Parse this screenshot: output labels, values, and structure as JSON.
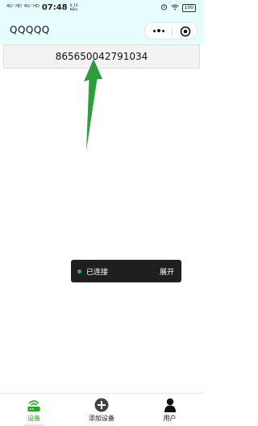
{
  "status_bar": {
    "signal_1": "4G⁺ HD",
    "signal_2": "4G⁺ HD",
    "time": "07:48",
    "net_speed": "6.10 KB/s",
    "battery": "100"
  },
  "title_bar": {
    "title": "QQQQQ",
    "more_icon": "more-dots-icon",
    "close_icon": "circle-target-icon"
  },
  "device_id": "865650042791034",
  "toast": {
    "status": "已连接",
    "expand": "展开",
    "dot_color": "#18c15a"
  },
  "tabs": [
    {
      "label": "设备",
      "icon": "router-icon",
      "active": true
    },
    {
      "label": "添加设备",
      "icon": "plus-circle-icon",
      "active": false
    },
    {
      "label": "用户",
      "icon": "user-icon",
      "active": false
    }
  ],
  "colors": {
    "accent": "#1aad19",
    "header_bg": "#e7fcfd",
    "arrow": "#2e9e3a"
  }
}
